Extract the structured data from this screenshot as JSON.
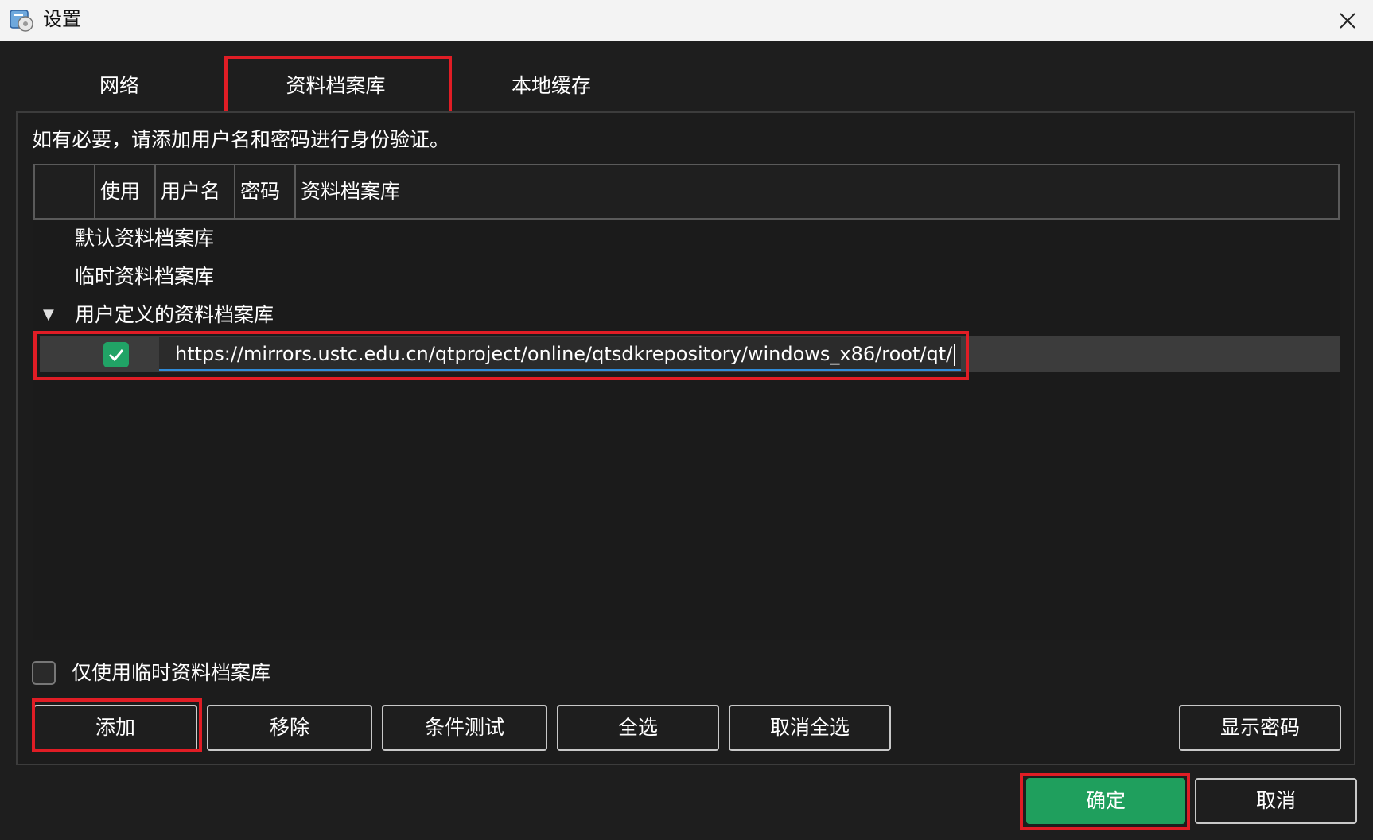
{
  "window": {
    "title": "设置",
    "icon": "settings-app-icon",
    "close_icon": "close-icon"
  },
  "tabs": [
    {
      "label": "网络"
    },
    {
      "label": "资料档案库",
      "active": true
    },
    {
      "label": "本地缓存"
    }
  ],
  "repos_page": {
    "info": "如有必要，请添加用户名和密码进行身份验证。",
    "columns": [
      "",
      "使用",
      "用户名",
      "密码",
      "资料档案库"
    ],
    "tree": {
      "default": "默认资料档案库",
      "temporary": "临时资料档案库",
      "user_defined": "用户定义的资料档案库",
      "user_repo_url": "https://mirrors.ustc.edu.cn/qtproject/online/qtsdkrepository/windows_x86/root/qt/",
      "user_repo_enabled": true
    },
    "only_temp_label": "仅使用临时资料档案库",
    "only_temp_checked": false
  },
  "buttons": {
    "add": "添加",
    "remove": "移除",
    "test": "条件测试",
    "select_all": "全选",
    "deselect_all": "取消全选",
    "show_password": "显示密码",
    "ok": "确定",
    "cancel": "取消"
  },
  "colors": {
    "background": "#1e1e1e",
    "accent_green": "#1f9f5d",
    "highlight_red": "#e01d25",
    "edit_underline": "#2f8bd9"
  }
}
